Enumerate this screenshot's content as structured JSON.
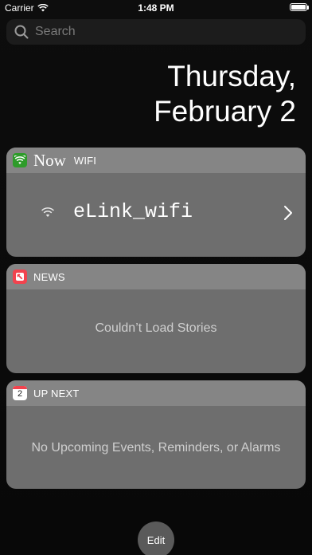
{
  "status_bar": {
    "carrier": "Carrier",
    "time": "1:48 PM",
    "battery_level": 1.0
  },
  "search": {
    "placeholder": "Search",
    "icon": "search-icon"
  },
  "date": {
    "weekday": "Thursday,",
    "month_day": "February 2"
  },
  "widgets": {
    "wifi": {
      "now_label": "Now",
      "title": "WIFI",
      "icon": "wifi-icon",
      "icon_color": "#2e9b2a",
      "network_name": "eLink_wifi"
    },
    "news": {
      "title": "NEWS",
      "icon": "news-icon",
      "icon_color": "#f2434e",
      "message": "Couldn’t Load Stories"
    },
    "up_next": {
      "title": "UP NEXT",
      "icon": "calendar-icon",
      "calendar_day": "2",
      "message": "No Upcoming Events, Reminders, or Alarms"
    }
  },
  "edit_label": "Edit"
}
